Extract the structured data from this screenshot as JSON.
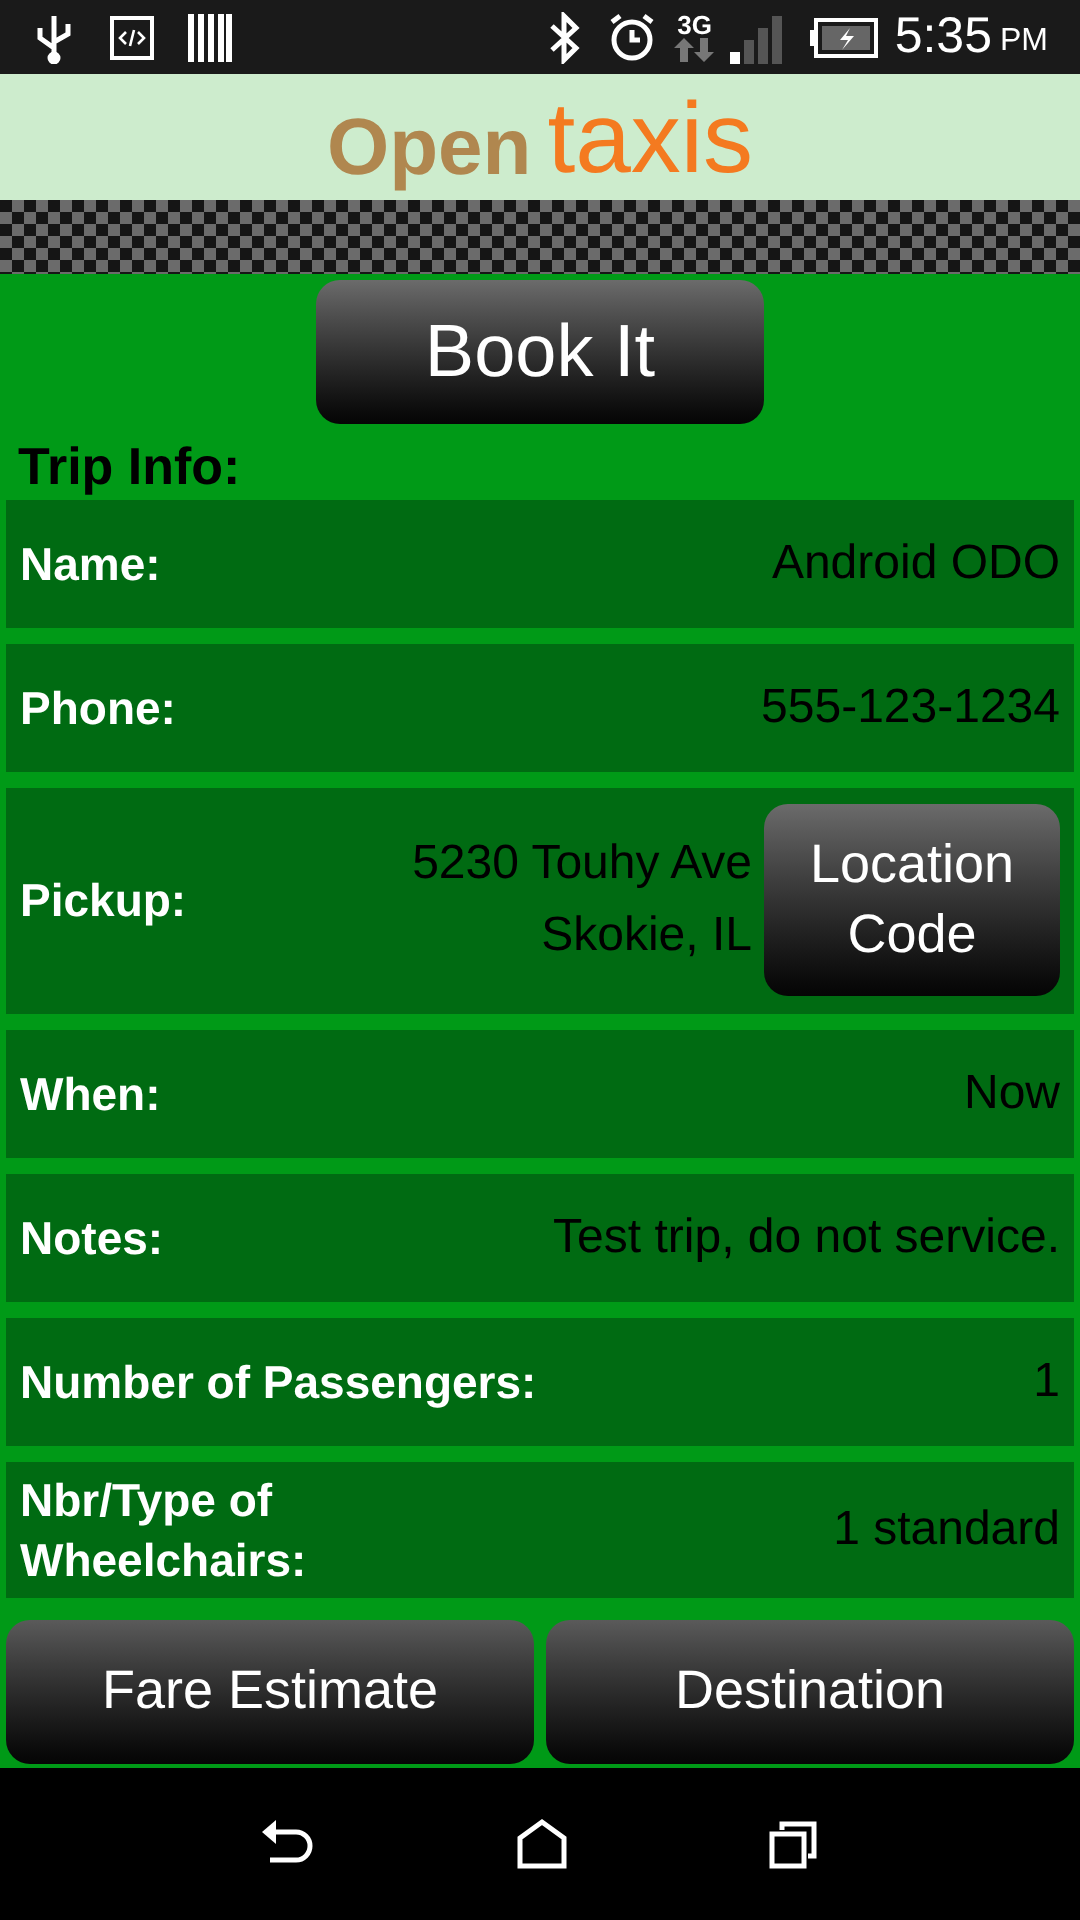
{
  "status_bar": {
    "network": "3G",
    "time": "5:35",
    "ampm": "PM"
  },
  "logo": {
    "first": "Open",
    "second": "taxis"
  },
  "book_button": "Book It",
  "section_title": "Trip Info:",
  "rows": [
    {
      "kind": "text",
      "label": "Name:",
      "value": "Android ODO"
    },
    {
      "kind": "text",
      "label": "Phone:",
      "value": "555-123-1234"
    },
    {
      "kind": "address",
      "label": "Pickup:",
      "lines": [
        "5230 Touhy Ave",
        "Skokie, IL"
      ],
      "button": [
        "Location",
        "Code"
      ]
    },
    {
      "kind": "text",
      "label": "When:",
      "value": "Now"
    },
    {
      "kind": "text",
      "label": "Notes:",
      "value": "Test trip, do not service."
    },
    {
      "kind": "text",
      "label": "Number of Passengers:",
      "value": "1"
    },
    {
      "kind": "text",
      "label_lines": [
        "Nbr/Type of",
        "Wheelchairs:"
      ],
      "value": "1 standard"
    }
  ],
  "bottom_buttons": [
    "Fare Estimate",
    "Destination"
  ]
}
